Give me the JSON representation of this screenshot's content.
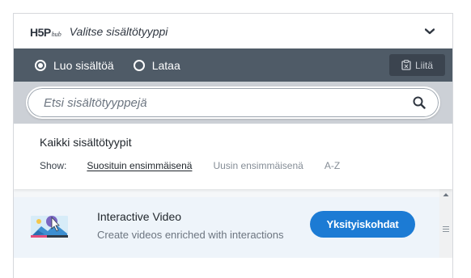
{
  "header": {
    "logo_main": "H5P",
    "logo_sub": "hub",
    "title": "Valitse sisältötyyppi",
    "chevron_icon": "chevron-down-icon"
  },
  "tabs": {
    "create_label": "Luo sisältöä",
    "create_selected": true,
    "upload_label": "Lataa",
    "paste_label": "Liitä",
    "paste_icon": "clipboard-paste-icon"
  },
  "search": {
    "placeholder": "Etsi sisältötyyppejä",
    "value": "",
    "icon": "search-icon"
  },
  "list_header": {
    "title": "Kaikki sisältötyypit",
    "show_label": "Show:",
    "sort_options": [
      "Suosituin ensimmäisenä",
      "Uusin ensimmäisenä",
      "A-Z"
    ],
    "active_sort": "Suosituin ensimmäisenä"
  },
  "items": [
    {
      "title": "Interactive Video",
      "description": "Create videos enriched with interactions",
      "button_label": "Yksityiskohdat",
      "icon": "interactive-video-icon"
    }
  ],
  "colors": {
    "tabbar": "#4f5b67",
    "search_area": "#ccd0d6",
    "primary_button": "#1c7bd4",
    "item_bg": "#eef4fa"
  }
}
